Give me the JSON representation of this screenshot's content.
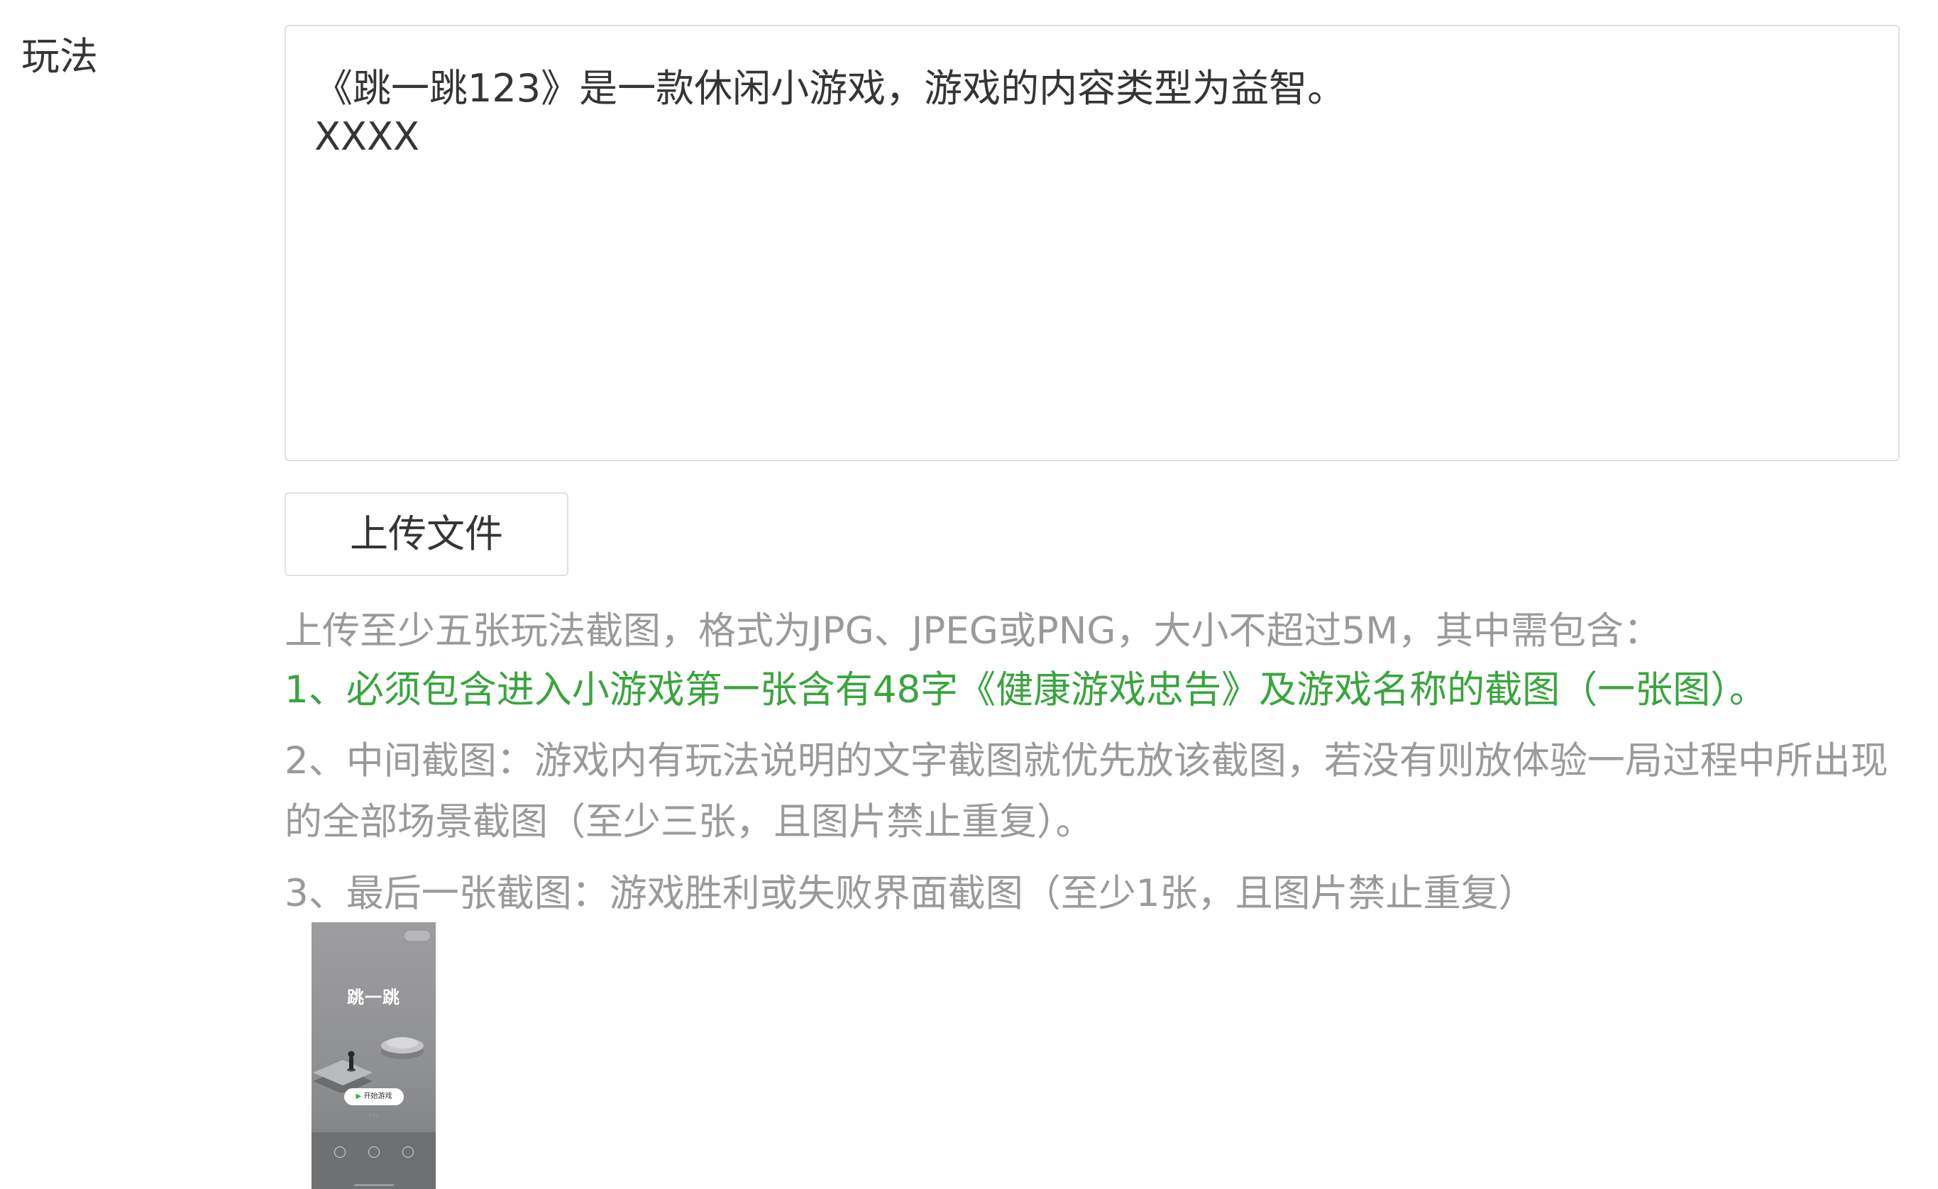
{
  "field": {
    "label": "玩法",
    "text_value": "《跳一跳123》是一款休闲小游戏，游戏的内容类型为益智。\nXXXX"
  },
  "upload": {
    "button_label": "上传文件"
  },
  "hints": {
    "intro": "上传至少五张玩法截图，格式为JPG、JPEG或PNG，大小不超过5M，其中需包含：",
    "rule1": "1、必须包含进入小游戏第一张含有48字《健康游戏忠告》及游戏名称的截图（一张图）。",
    "rule2": "2、中间截图：游戏内有玩法说明的文字截图就优先放该截图，若没有则放体验一局过程中所出现的全部场景截图（至少三张，且图片禁止重复）。",
    "rule3": "3、最后一张截图：游戏胜利或失败界面截图（至少1张，且图片禁止重复）"
  },
  "colors": {
    "highlight_green": "#39a53e",
    "hint_gray": "#9a9a9a"
  },
  "thumbnail": {
    "game_title": "跳一跳",
    "start_label": "开始游戏"
  }
}
